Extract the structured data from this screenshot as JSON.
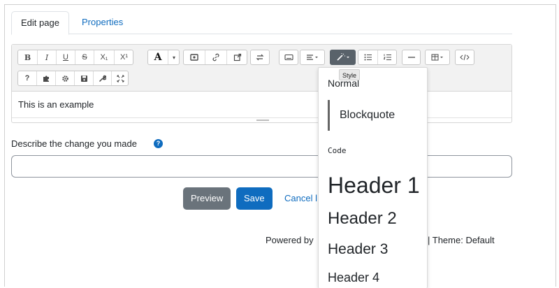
{
  "tabs": [
    {
      "label": "Edit page",
      "active": true
    },
    {
      "label": "Properties",
      "active": false
    }
  ],
  "toolbar": {
    "row1": [
      "B",
      "I",
      "U",
      "S",
      "X₁",
      "X¹",
      "A",
      "▾",
      "image-icon",
      "link-icon",
      "external-link-icon",
      "swap-icon",
      "keyboard-icon",
      "align-icon",
      "style-magic-icon",
      "bullet-list-icon",
      "number-list-icon",
      "hr-icon",
      "table-icon",
      "code-icon"
    ],
    "row2": [
      "?",
      "puzzle-icon",
      "gear-icon",
      "save-icon",
      "wrench-icon",
      "expand-icon"
    ]
  },
  "editor": {
    "content": "This is an example"
  },
  "describe": {
    "label": "Describe the change you made",
    "help_icon": "question-circle-icon",
    "value": ""
  },
  "buttons": {
    "preview": "Preview",
    "save": "Save",
    "cancel": "Cancel l"
  },
  "footer": {
    "left": "Powered by",
    "right": "| Theme: Default"
  },
  "tooltip": "Style",
  "style_menu": {
    "normal": "Normal",
    "blockquote": "Blockquote",
    "code": "Code",
    "h1": "Header 1",
    "h2": "Header 2",
    "h3": "Header 3",
    "h4": "Header 4"
  },
  "colors": {
    "primary": "#0f6cbf",
    "secondary": "#6a737b",
    "toolbar_bg": "#f2f2f2",
    "style_active": "#59626a"
  }
}
